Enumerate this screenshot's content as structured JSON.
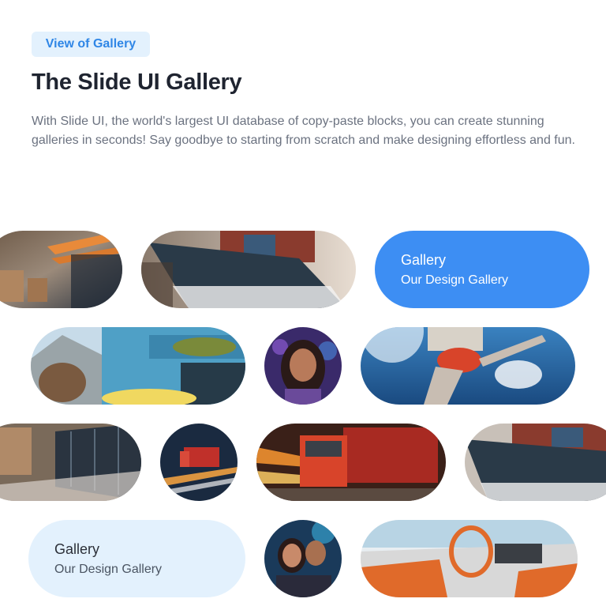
{
  "header": {
    "badge_label": "View of Gallery",
    "title": "The Slide UI Gallery",
    "description": "With Slide UI, the world's largest UI database of copy-paste blocks, you can create stunning galleries in seconds! Say goodbye to starting from scratch and make designing effortless and fun."
  },
  "cards": {
    "blue": {
      "title": "Gallery",
      "subtitle": "Our Design Gallery"
    },
    "light": {
      "title": "Gallery",
      "subtitle": "Our Design Gallery"
    }
  },
  "colors": {
    "accent": "#3d8ef3",
    "badge_bg": "#e3f1fd",
    "badge_text": "#2f86e6"
  }
}
